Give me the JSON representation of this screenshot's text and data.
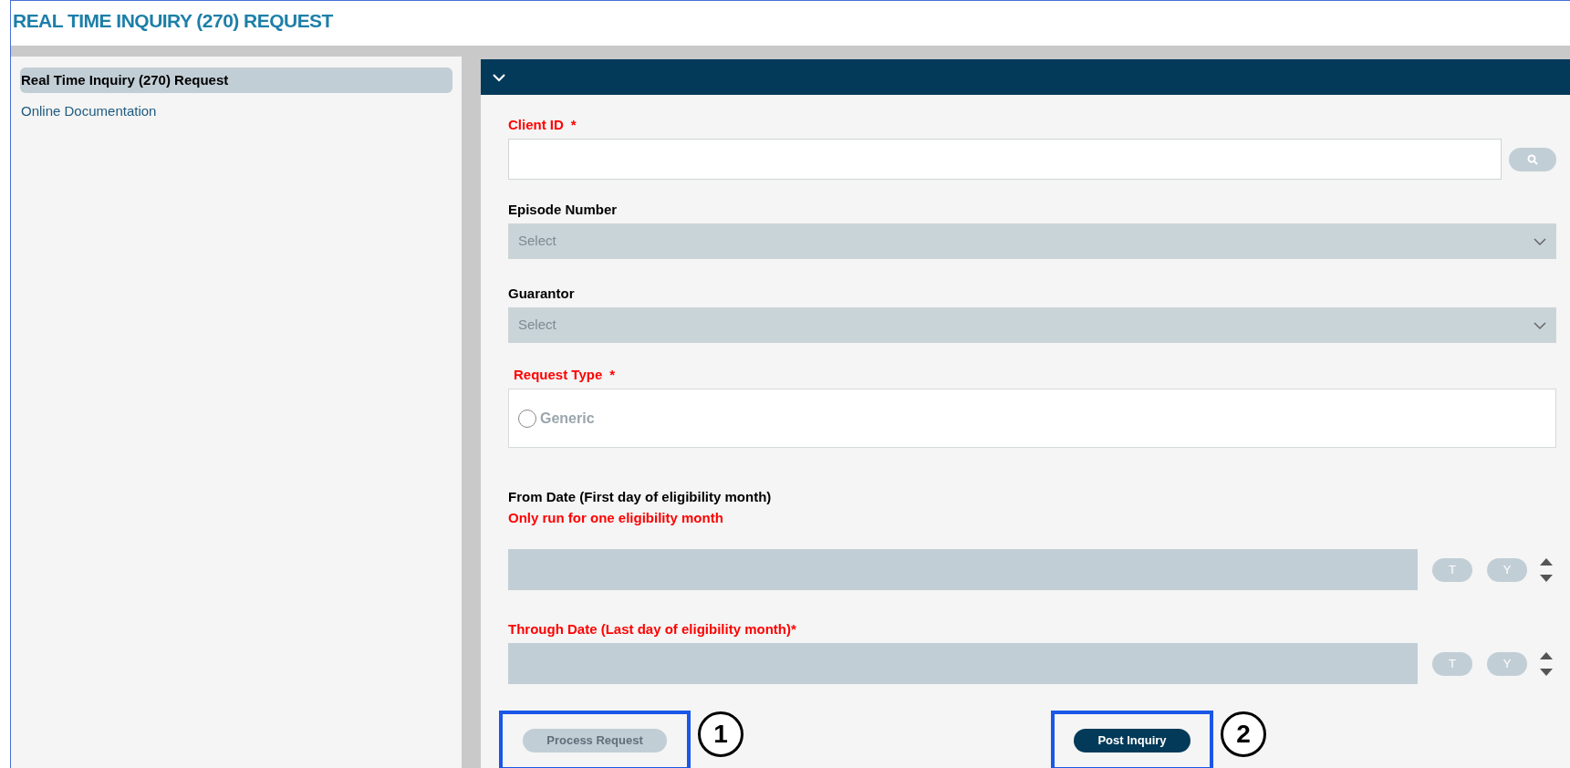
{
  "window": {
    "title": "REAL TIME INQUIRY (270) REQUEST"
  },
  "sidebar": {
    "items": [
      {
        "label": "Real Time Inquiry (270) Request",
        "selected": true
      },
      {
        "label": "Online Documentation",
        "selected": false
      }
    ]
  },
  "form": {
    "expanded": true,
    "fields": [
      {
        "kind": "text",
        "label": "Client ID",
        "asterisk": "*",
        "required": true,
        "search_button": true
      },
      {
        "kind": "select",
        "label": "Episode Number",
        "required": false,
        "placeholder": "Select",
        "disabled": true
      },
      {
        "kind": "select",
        "label": "Guarantor",
        "required": false,
        "placeholder": "Select",
        "disabled": true
      },
      {
        "kind": "radio",
        "label": "Request Type",
        "asterisk": "*",
        "required": true,
        "options": [
          {
            "label": "Generic",
            "checked": false,
            "disabled": true
          }
        ]
      },
      {
        "kind": "date",
        "label": "From Date (First day of eligibility month)",
        "note": "Only run for one eligibility month",
        "required": false,
        "disabled": true,
        "buttons": [
          "T",
          "Y"
        ]
      },
      {
        "kind": "date",
        "label": "Through Date (Last day of eligibility month)*",
        "required": true,
        "disabled": true,
        "buttons": [
          "T",
          "Y"
        ]
      }
    ]
  },
  "actions": [
    {
      "label": "Process Request",
      "disabled": true,
      "callout": "1"
    },
    {
      "label": "Post Inquiry",
      "disabled": false,
      "callout": "2"
    }
  ]
}
